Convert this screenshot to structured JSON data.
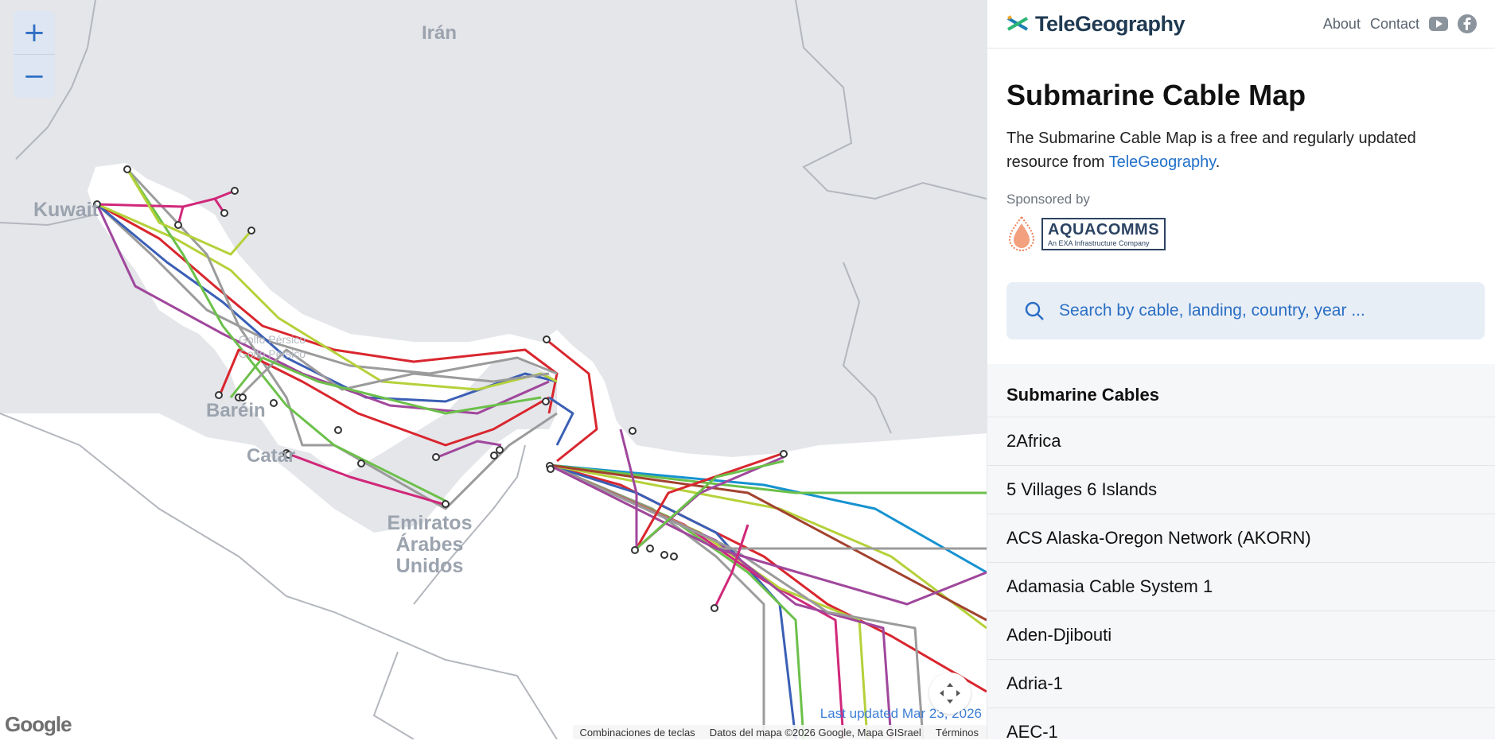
{
  "map": {
    "zoom_in": "+",
    "zoom_out": "−",
    "labels": {
      "iran": "Irán",
      "kuwait": "Kuwait",
      "bahrain": "Baréin",
      "qatar": "Catar",
      "uae_line1": "Emiratos",
      "uae_line2": "Árabes",
      "uae_line3": "Unidos",
      "gulf_line1": "Golfo Pérsico",
      "gulf_line2": "Golfo Pérsico"
    },
    "google_logo": "Google",
    "last_updated": "Last updated Mar 23, 2026",
    "attribution": {
      "shortcuts": "Combinaciones de teclas",
      "data": "Datos del mapa ©2026 Google, Mapa GISrael",
      "terms": "Términos"
    },
    "cable_colors": [
      "#d9262e",
      "#9b9b9b",
      "#3a5fb5",
      "#b5d13a",
      "#6cc04a",
      "#d0287a",
      "#a0479c",
      "#1592d0",
      "#a2422e"
    ]
  },
  "header": {
    "brand": "TeleGeography",
    "nav": {
      "about": "About",
      "contact": "Contact"
    },
    "icons": [
      "youtube-icon",
      "facebook-icon"
    ]
  },
  "intro": {
    "title": "Submarine Cable Map",
    "description": "The Submarine Cable Map is a free and regularly updated resource from ",
    "link": "TeleGeography",
    "period": ".",
    "sponsored_by": "Sponsored by",
    "sponsor_name": "AQUACOMMS",
    "sponsor_tagline": "An EXA Infrastructure Company"
  },
  "search": {
    "placeholder": "Search by cable, landing, country, year ..."
  },
  "cables": {
    "heading": "Submarine Cables",
    "items": [
      "2Africa",
      "5 Villages 6 Islands",
      "ACS Alaska-Oregon Network (AKORN)",
      "Adamasia Cable System 1",
      "Aden-Djibouti",
      "Adria-1",
      "AEC-1"
    ]
  },
  "colors": {
    "accent": "#1f6fc9",
    "map_bg": "#e4e6ea",
    "land": "#ffffff"
  }
}
